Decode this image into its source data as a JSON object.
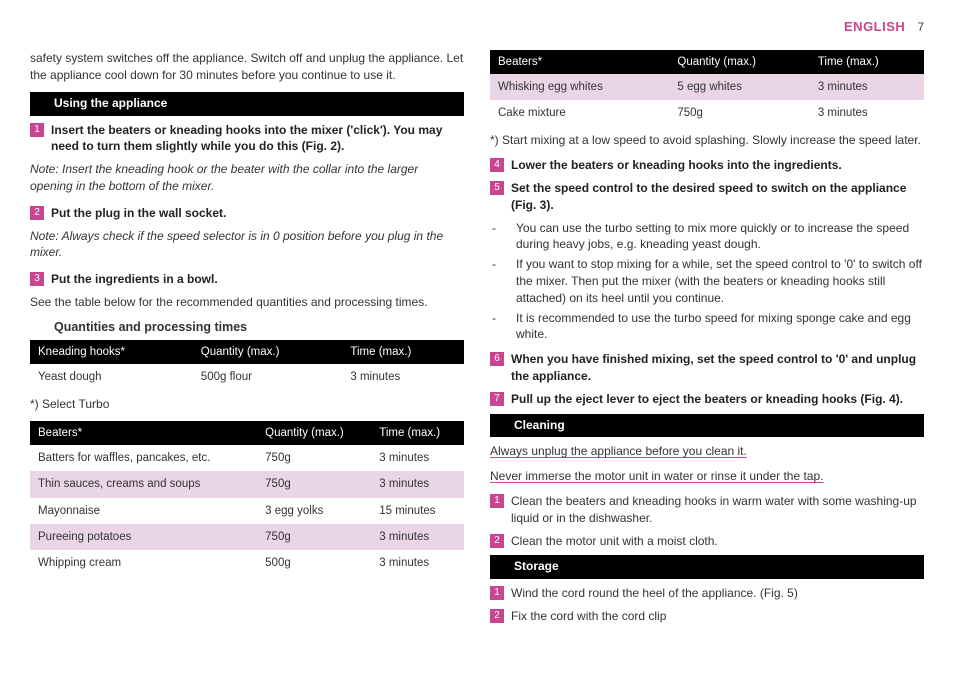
{
  "header": {
    "language": "ENGLISH",
    "page_number": "7"
  },
  "left": {
    "intro": "safety system switches off the appliance. Switch off and unplug the appliance. Let the appliance cool down for 30 minutes before you continue to use it.",
    "using_heading": "Using the appliance",
    "step1": "Insert the beaters or kneading hooks into the mixer ('click'). You may need to turn them slightly while you do this (Fig. 2).",
    "note1": "Note: Insert the kneading hook or the beater with the collar into the larger opening in the bottom of the mixer.",
    "step2": "Put the plug in the wall socket.",
    "note2": "Note: Always check if the speed selector is in 0 position before you plug in the mixer.",
    "step3": "Put the ingredients in a bowl.",
    "after3": "See the table below for the recommended quantities and processing times.",
    "qpt_heading": "Quantities and processing times",
    "table1": {
      "headers": [
        "Kneading hooks*",
        "Quantity (max.)",
        "Time (max.)"
      ],
      "rows": [
        {
          "c1": "Yeast dough",
          "c2": "500g flour",
          "c3": "3 minutes"
        }
      ]
    },
    "foot1": "*) Select Turbo",
    "table2": {
      "headers": [
        "Beaters*",
        "Quantity (max.)",
        "Time (max.)"
      ],
      "rows": [
        {
          "c1": "Batters for waffles, pancakes, etc.",
          "c2": "750g",
          "c3": "3 minutes"
        },
        {
          "c1": "Thin sauces, creams and soups",
          "c2": "750g",
          "c3": "3 minutes"
        },
        {
          "c1": "Mayonnaise",
          "c2": "3 egg yolks",
          "c3": "15 minutes"
        },
        {
          "c1": "Pureeing potatoes",
          "c2": "750g",
          "c3": "3 minutes"
        },
        {
          "c1": "Whipping cream",
          "c2": "500g",
          "c3": "3 minutes"
        }
      ]
    }
  },
  "right": {
    "table3": {
      "headers": [
        "Beaters*",
        "Quantity (max.)",
        "Time (max.)"
      ],
      "rows": [
        {
          "c1": "Whisking egg whites",
          "c2": "5 egg whites",
          "c3": "3 minutes"
        },
        {
          "c1": "Cake mixture",
          "c2": "750g",
          "c3": "3 minutes"
        }
      ]
    },
    "foot2": "*) Start mixing at a low speed to avoid splashing. Slowly increase the speed later.",
    "step4": "Lower the beaters or kneading hooks into the ingredients.",
    "step5": "Set the speed control to the desired speed to switch on the appliance (Fig. 3).",
    "dash1": "You can use the turbo setting to mix more quickly or to increase the speed during heavy jobs, e.g. kneading yeast dough.",
    "dash2": "If you want to stop mixing for a while, set the speed control to '0' to switch off the mixer. Then put the mixer (with the beaters or kneading hooks still attached) on its heel until you continue.",
    "dash3": "It is recommended to use the turbo speed for mixing sponge cake and egg white.",
    "step6": "When you have finished mixing, set the speed control to '0' and unplug the appliance.",
    "step7": "Pull up the eject lever to eject the beaters or kneading hooks (Fig. 4).",
    "cleaning_heading": "Cleaning",
    "clean_u1": "Always unplug the appliance before you clean it.",
    "clean_u2": "Never immerse the motor unit in water or rinse it under the tap.",
    "clean1": "Clean the beaters and kneading hooks in warm water with some washing-up liquid or in the dishwasher.",
    "clean2": "Clean the motor unit with a moist cloth.",
    "storage_heading": "Storage",
    "store1": "Wind the cord round the heel of the appliance.  (Fig. 5)",
    "store2": "Fix the cord with the cord clip"
  }
}
